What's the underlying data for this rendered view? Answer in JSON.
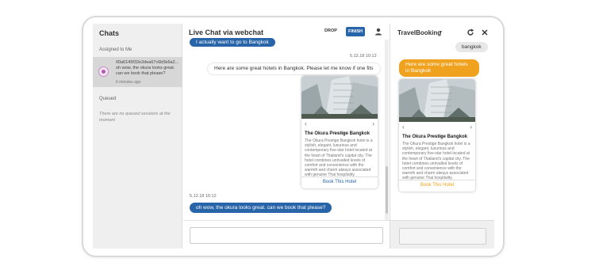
{
  "sidebar": {
    "title": "Chats",
    "assigned_label": "Assigned to Me",
    "session": {
      "id": "00a6145f32e2dea67c6b5b6a2...",
      "message": "oh wow, the okura looks great. can we book that please?",
      "time": "6 minutes ago"
    },
    "queued_label": "Queued",
    "queued_empty": "There are no queued sessions at the moment"
  },
  "chat": {
    "title": "Live Chat via webchat",
    "drop_label": "DROP",
    "finish_label": "FINISH",
    "person_icon": "person-icon",
    "user_msg_top": "I actually want to go to Bangkok",
    "timestamp1": "5.12.18 10:12",
    "bot_msg": "Here are some great hotels in Bangkok. Please let me know if one fits",
    "card": {
      "title": "The Okura Prestige Bangkok",
      "description": "The Okura Prestige Bangkok hotel is a stylish, elegant, luxurious and contemporary five-star hotel located at the heart of Thailand's capital city. The hotel combines unrivalled levels of comfort and convenience with the warmth and charm always associated with genuine Thai hospitality.",
      "action": "Book This Hotel",
      "action_color": "#2764a8"
    },
    "timestamp2": "5.12.18 10:12",
    "user_msg_bottom": "oh wow, the okura looks great. can we book that please?",
    "composer_placeholder": ""
  },
  "preview": {
    "title": "TravelBooking",
    "caret_icon": "chevron-down-icon",
    "refresh_icon": "refresh-icon",
    "close_icon": "close-icon",
    "user_msg": "bangkok",
    "bot_msg": "Here are some great hotels in Bangkok",
    "bot_color": "#f0a11d",
    "card": {
      "title": "The Okura Prestige Bangkok",
      "description": "The Okura Prestige Bangkok hotel is a stylish, elegant, luxurious and contemporary five-star hotel located at the heart of Thailand's capital city. The hotel combines unrivalled levels of comfort and convenience with the warmth and charm always associated with genuine Thai hospitality.",
      "action": "Book This Hotel",
      "action_color": "#f0a11d"
    }
  },
  "colors": {
    "accent_blue": "#2764a8",
    "accent_orange": "#f0a11d"
  }
}
